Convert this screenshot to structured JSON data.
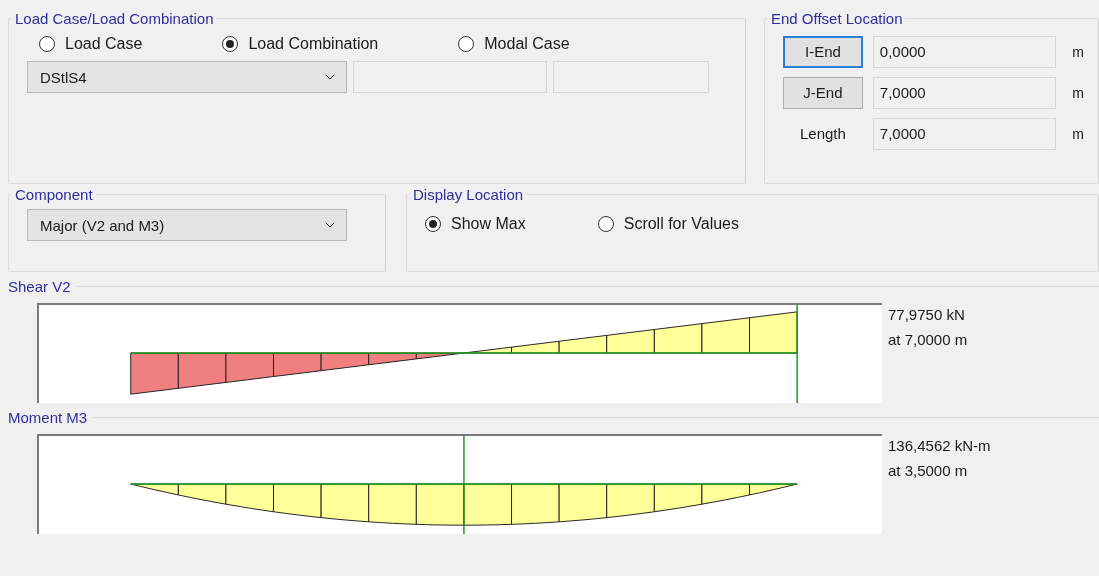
{
  "load_case_group": {
    "title": "Load Case/Load Combination",
    "options": [
      {
        "label": "Load Case",
        "selected": false
      },
      {
        "label": "Load Combination",
        "selected": true
      },
      {
        "label": "Modal Case",
        "selected": false
      }
    ],
    "case_select": {
      "value": "DStlS4"
    }
  },
  "end_offset_group": {
    "title": "End Offset Location",
    "rows": [
      {
        "kind": "button",
        "label": "I-End",
        "focused": true,
        "value": "0,0000",
        "unit": "m"
      },
      {
        "kind": "button",
        "label": "J-End",
        "focused": false,
        "value": "7,0000",
        "unit": "m"
      },
      {
        "kind": "label",
        "label": "Length",
        "value": "7,0000",
        "unit": "m"
      }
    ]
  },
  "component_group": {
    "title": "Component",
    "value": "Major (V2 and M3)"
  },
  "display_location_group": {
    "title": "Display Location",
    "options": [
      {
        "label": "Show Max",
        "selected": true
      },
      {
        "label": "Scroll for Values",
        "selected": false
      }
    ]
  },
  "diagrams": [
    {
      "title": "Shear V2",
      "kind": "shear",
      "value": "77,9750 kN",
      "location": "at 7,0000 m"
    },
    {
      "title": "Moment M3",
      "kind": "moment",
      "value": "136,4562 kN-m",
      "location": "at 3,5000 m"
    }
  ]
}
